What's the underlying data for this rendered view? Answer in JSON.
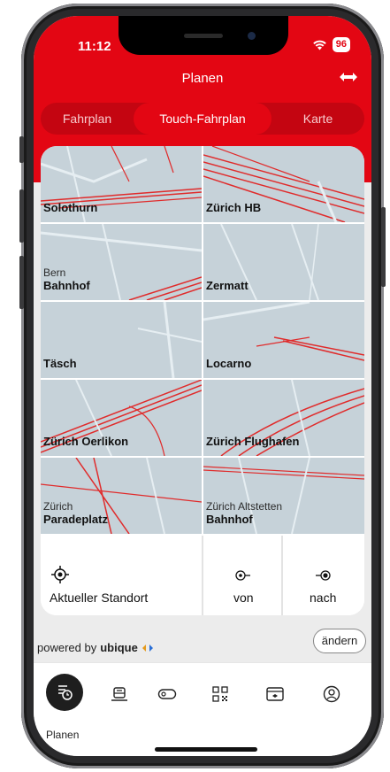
{
  "status": {
    "time": "11:12",
    "battery": "96"
  },
  "header": {
    "title": "Planen",
    "swap_icon": "swap-arrows-icon"
  },
  "segments": [
    {
      "label": "Fahrplan",
      "active": false
    },
    {
      "label": "Touch-Fahrplan",
      "active": true
    },
    {
      "label": "Karte",
      "active": false
    }
  ],
  "tiles": [
    {
      "sub": "",
      "name": "Solothurn"
    },
    {
      "sub": "",
      "name": "Zürich HB"
    },
    {
      "sub": "Bern",
      "name": "Bahnhof"
    },
    {
      "sub": "",
      "name": "Zermatt"
    },
    {
      "sub": "",
      "name": "Täsch"
    },
    {
      "sub": "",
      "name": "Locarno"
    },
    {
      "sub": "",
      "name": "Zürich Oerlikon"
    },
    {
      "sub": "",
      "name": "Zürich Flughafen"
    },
    {
      "sub": "Zürich",
      "name": "Paradeplatz"
    },
    {
      "sub": "Zürich Altstetten",
      "name": "Bahnhof"
    }
  ],
  "actions": {
    "current_location": "Aktueller Standort",
    "from": "von",
    "to": "nach"
  },
  "footer": {
    "powered_by": "powered by",
    "brand": "ubique",
    "change_button": "ändern"
  },
  "tabbar": {
    "active_label": "Planen",
    "items": [
      "timetable-icon",
      "train-icon",
      "ticket-icon",
      "qr-code-icon",
      "travelcard-icon",
      "profile-icon"
    ]
  },
  "colors": {
    "brand_red": "#e30613",
    "dark_red": "#c40511",
    "map_bg": "#c6d2d9",
    "track_red": "#e02b2b"
  }
}
